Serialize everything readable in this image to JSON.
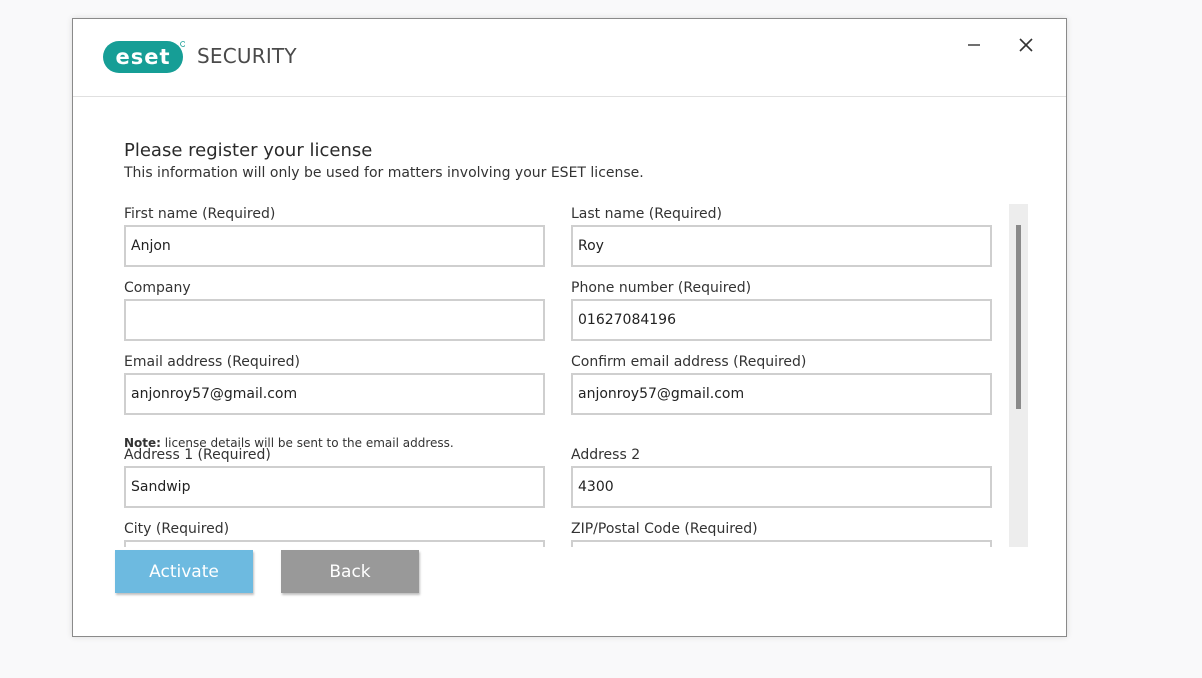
{
  "brand": {
    "badge_text": "eset",
    "product_text": "SECURITY",
    "color": "#169e96"
  },
  "window_controls": {
    "minimize_icon": "minimize-icon",
    "close_icon": "close-icon"
  },
  "form": {
    "heading": "Please register your license",
    "subheading": "This information will only be used for matters involving your ESET license.",
    "fields": {
      "first_name": {
        "label": "First name (Required)",
        "value": "Anjon"
      },
      "last_name": {
        "label": "Last name (Required)",
        "value": "Roy"
      },
      "company": {
        "label": "Company",
        "value": ""
      },
      "phone": {
        "label": "Phone number (Required)",
        "value": "01627084196"
      },
      "email": {
        "label": "Email address (Required)",
        "value": "anjonroy57@gmail.com"
      },
      "confirm_email": {
        "label": "Confirm email address (Required)",
        "value": "anjonroy57@gmail.com"
      },
      "address1": {
        "label": "Address 1 (Required)",
        "value": "Sandwip"
      },
      "address2": {
        "label": "Address 2",
        "value": "4300"
      },
      "city": {
        "label": "City (Required)",
        "value": ""
      },
      "zip": {
        "label": "ZIP/Postal Code (Required)",
        "value": ""
      }
    },
    "note_label": "Note:",
    "note_text": " license details will be sent to the email address."
  },
  "actions": {
    "activate_label": "Activate",
    "back_label": "Back",
    "activate_color": "#6dbae0",
    "back_color": "#999999"
  }
}
